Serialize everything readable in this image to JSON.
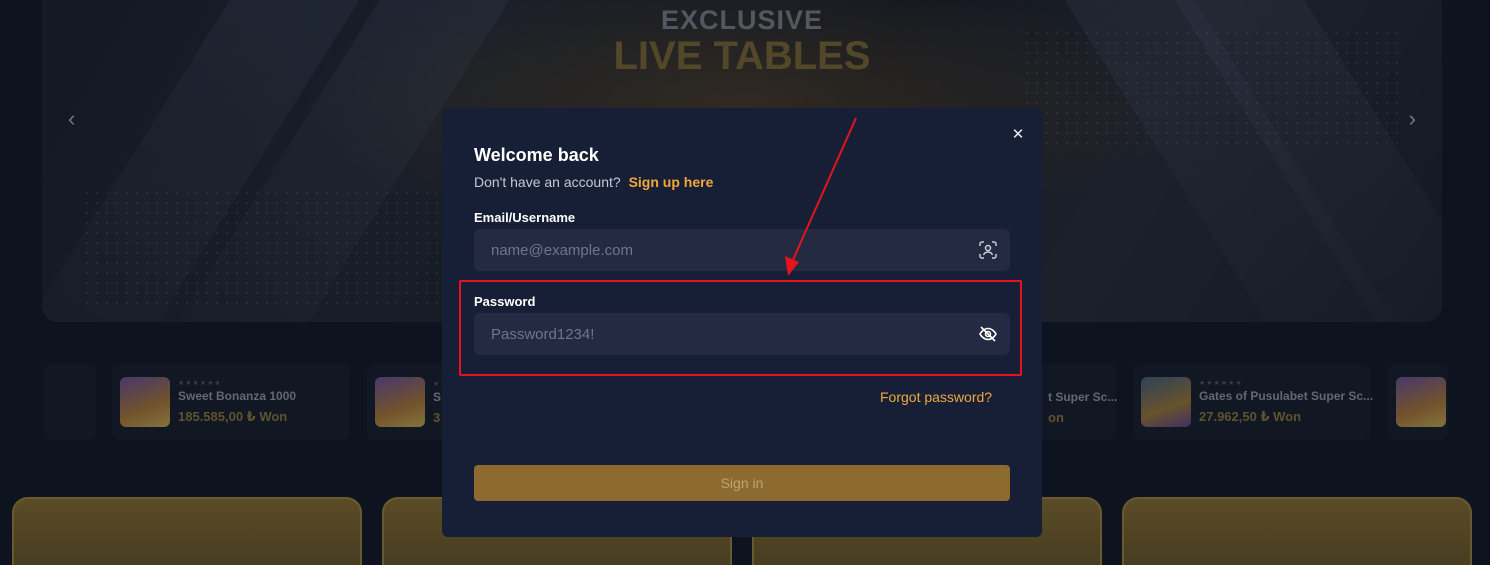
{
  "banner": {
    "title_line1": "EXCLUSIVE",
    "title_line2": "LIVE TABLES",
    "prev_icon": "chevron-left-icon",
    "next_icon": "chevron-right-icon"
  },
  "ticker": [
    {
      "name": "Sweet Bonanza 1000",
      "amount": "185.585,00 ₺ Won"
    },
    {
      "name": "S",
      "amount": "3"
    },
    {
      "name": "t Super Sc...",
      "amount": "on"
    },
    {
      "name": "Gates of Pusulabet Super Sc...",
      "amount": "27.962,50 ₺ Won"
    }
  ],
  "modal": {
    "close_icon": "close-icon",
    "title": "Welcome back",
    "subtitle": "Don't have an account?",
    "signup_link": "Sign up here",
    "email_label": "Email/Username",
    "email_placeholder": "name@example.com",
    "email_icon": "face-scan-icon",
    "password_label": "Password",
    "password_placeholder": "Password1234!",
    "password_icon": "eye-off-icon",
    "forgot_link": "Forgot password?",
    "signin_label": "Sign in"
  },
  "colors": {
    "accent": "#f0a83a",
    "modal_bg": "#171f37",
    "input_bg": "#232a41",
    "button_bg": "#8d6a30",
    "annotation": "#e3141b"
  }
}
